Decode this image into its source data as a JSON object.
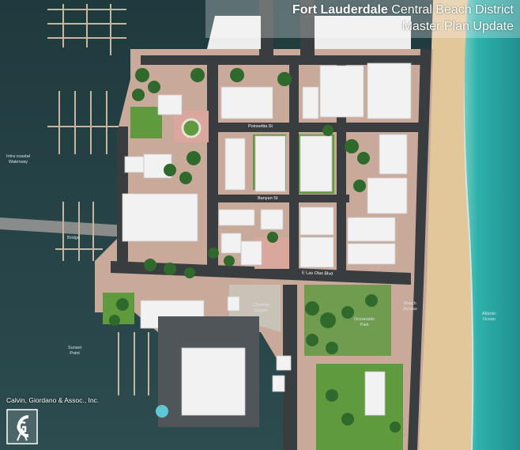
{
  "title": {
    "bold": "Fort Lauderdale",
    "rest": " Central Beach District",
    "line2": "Master Plan Update"
  },
  "credit": "Calvin, Giordano & Assoc., Inc.",
  "logo_letters": "CGA",
  "labels": {
    "intracoastal": "Intra coastal",
    "waterway": "Waterway",
    "bridge": "Bridge",
    "sunset": "Sunset",
    "point": "Point",
    "poinsettia": "Poinsettia St",
    "banyan": "Banyan St",
    "las_olas": "E Las Olas Blvd",
    "channel": "Channel",
    "square": "Square",
    "oceanside": "Oceanside",
    "park": "Park",
    "beach": "Beach",
    "access": "Access",
    "atlantic": "Atlantic",
    "ocean": "Ocean"
  },
  "colors": {
    "water_bay": "#2b4a4e",
    "ocean": "#2aa3a1",
    "sand": "#e2c79a",
    "road": "#3a3d3f",
    "plaza": "#d9a79c",
    "grass": "#5f9a3e",
    "tree": "#2f6a2c",
    "building": "#f2f2f2"
  }
}
